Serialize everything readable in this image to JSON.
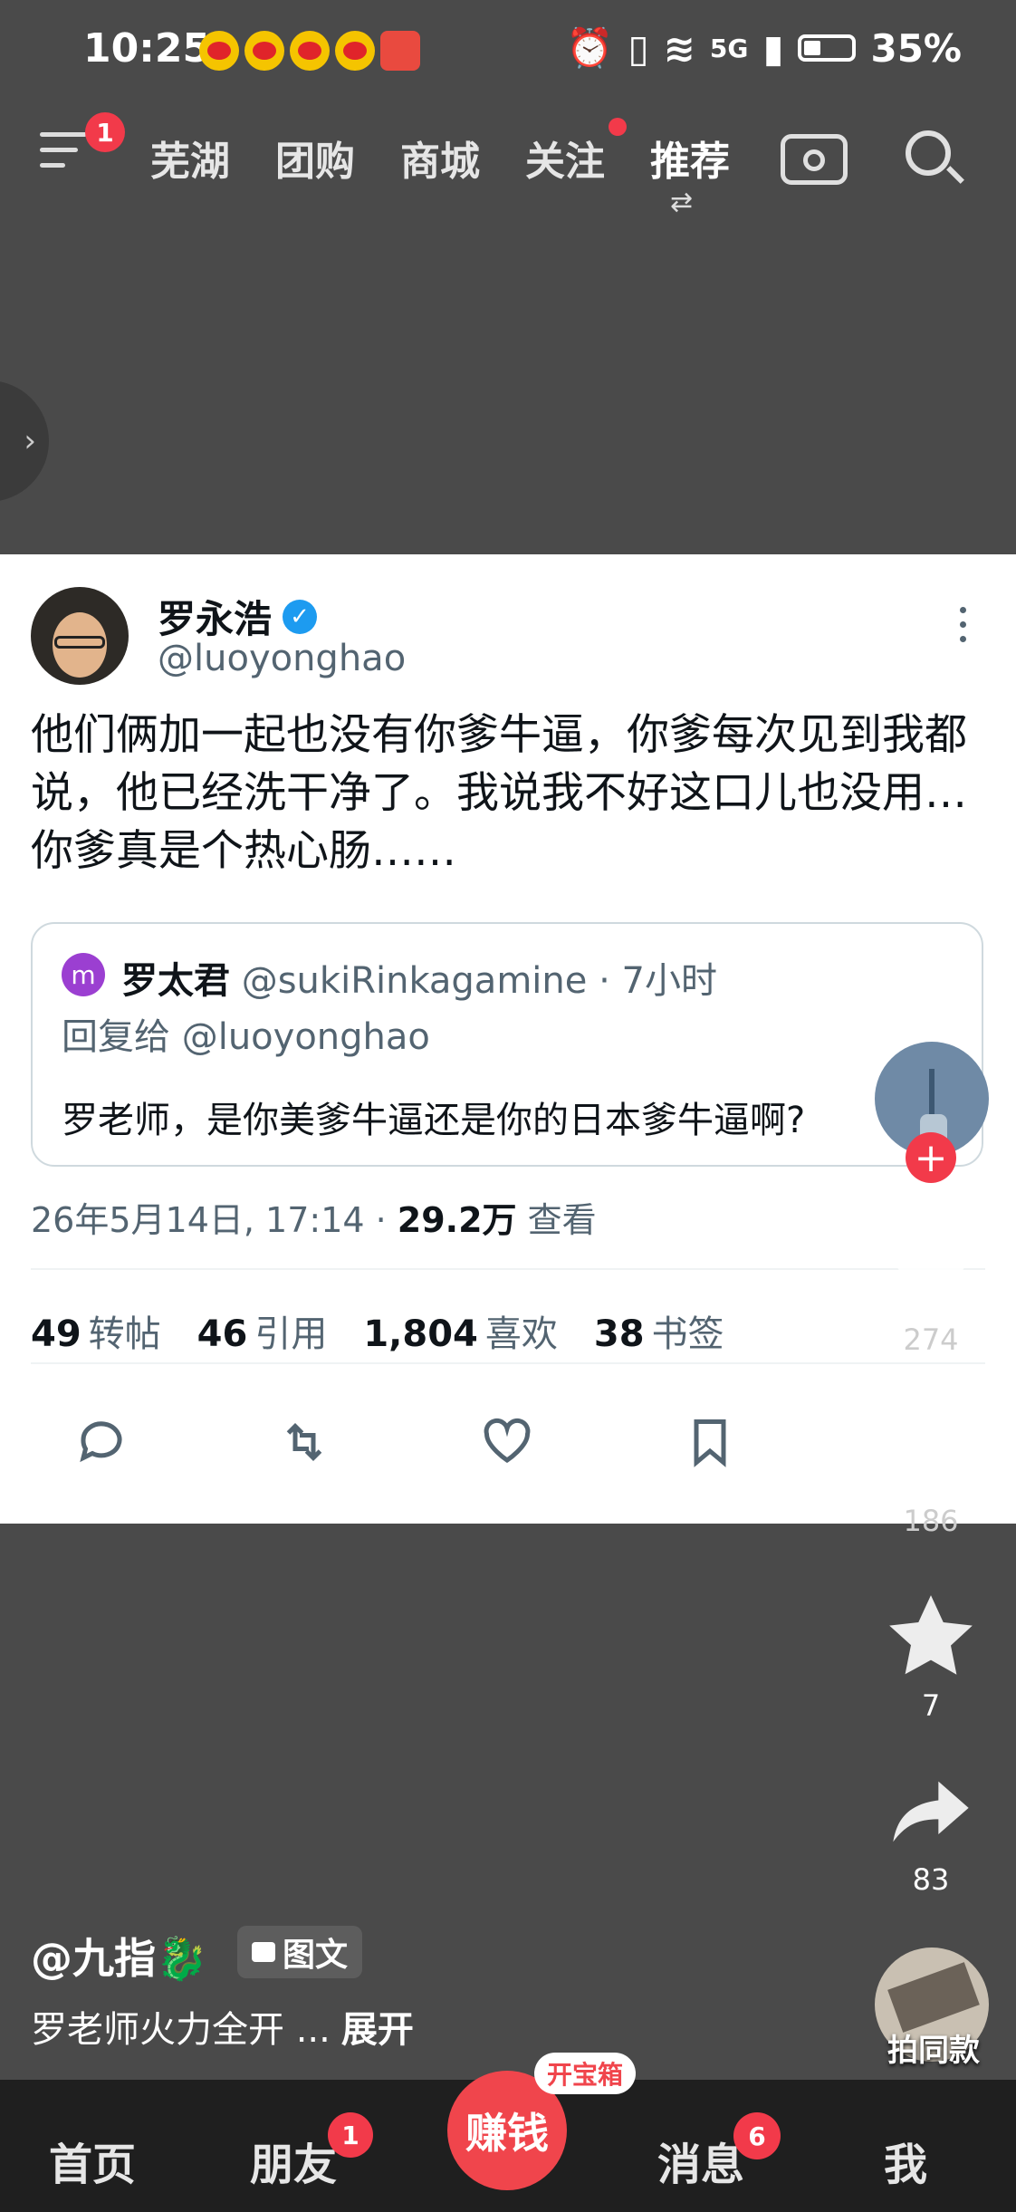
{
  "status_bar": {
    "time": "10:25",
    "signal": "5G",
    "battery": "35%"
  },
  "top_nav": {
    "menu_badge": "1",
    "tabs": [
      {
        "label": "芜湖"
      },
      {
        "label": "团购"
      },
      {
        "label": "商城"
      },
      {
        "label": "关注"
      },
      {
        "label": "推荐"
      }
    ]
  },
  "tweet": {
    "author_name": "罗永浩",
    "author_handle": "@luoyonghao",
    "text": "他们俩加一起也没有你爹牛逼，你爹每次见到我都说，他已经洗干净了。我说我不好这口儿也没用…你爹真是个热心肠……",
    "quote": {
      "avatar_letter": "m",
      "name": "罗太君",
      "handle_time": "@sukiRinkagamine · 7小时",
      "reply_to": "回复给 @luoyonghao",
      "text": "罗老师，是你美爹牛逼还是你的日本爹牛逼啊?"
    },
    "timestamp": "26年5月14日, 17:14 · ",
    "views_count": "29.2万",
    "views_label": " 查看",
    "stats": [
      {
        "count": "49",
        "label": "转帖"
      },
      {
        "count": "46",
        "label": "引用"
      },
      {
        "count": "1,804",
        "label": "喜欢"
      },
      {
        "count": "38",
        "label": "书签"
      }
    ]
  },
  "right_rail": {
    "like_count": "274",
    "comment_count": "186",
    "favorite_count": "7",
    "share_count": "83",
    "same_style_label": "拍同款"
  },
  "post": {
    "author": "@九指🐉",
    "tag": "图文",
    "caption": "罗老师火力全开 ...",
    "expand": "展开"
  },
  "bottom_nav": {
    "home": "首页",
    "friends": "朋友",
    "friends_badge": "1",
    "earn": "赚钱",
    "earn_tag": "开宝箱",
    "messages": "消息",
    "messages_badge": "6",
    "me": "我"
  },
  "colors": {
    "accent_red": "#f23a4a",
    "verified_blue": "#1d9bf0",
    "background": "#4a4a4a"
  }
}
